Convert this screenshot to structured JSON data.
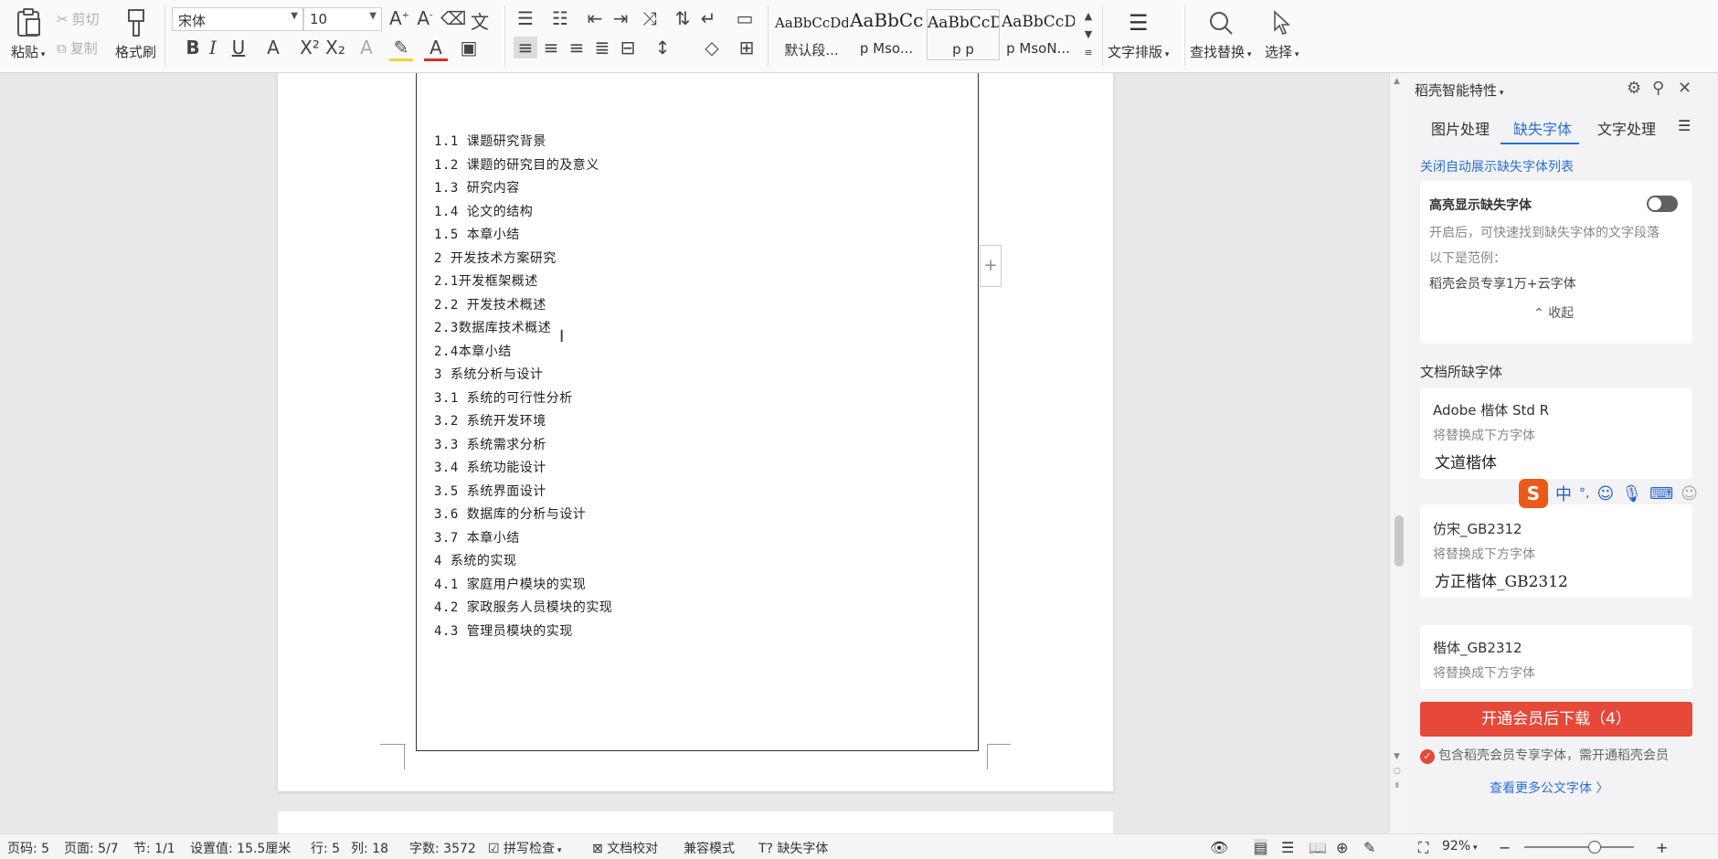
{
  "toolbar": {
    "paste": "粘贴",
    "cut": "剪切",
    "copy": "复制",
    "format_painter": "格式刷",
    "font_name": "宋体",
    "font_size": "10",
    "styles": [
      {
        "sample": "AaBbCcDd",
        "name": "默认段..."
      },
      {
        "sample": "AaBbCcI",
        "name": "p Mso..."
      },
      {
        "sample": "AaBbCcDd",
        "name": "p p"
      },
      {
        "sample": "AaBbCcDd",
        "name": "p MsoN..."
      }
    ],
    "text_layout": "文字排版",
    "find_replace": "查找替换",
    "select": "选择"
  },
  "document": {
    "toc": [
      "1.1  课题研究背景",
      "1.2  课题的研究目的及意义",
      "1.3 研究内容",
      "1.4 论文的结构",
      "1.5 本章小结",
      " 2 开发技术方案研究",
      "2.1开发框架概述",
      "2.2 开发技术概述",
      "2.3数据库技术概述",
      "2.4本章小结",
      " 3 系统分析与设计",
      "3.1 系统的可行性分析",
      "3.2 系统开发环境",
      "3.3 系统需求分析",
      "3.4 系统功能设计",
      "3.5 系统界面设计",
      "3.6 数据库的分析与设计",
      "3.7  本章小结",
      " 4 系统的实现",
      "4.1 家庭用户模块的实现",
      "4.2 家政服务人员模块的实现",
      "4.3 管理员模块的实现"
    ]
  },
  "panel": {
    "title": "稻壳智能特性",
    "tabs": [
      "图片处理",
      "缺失字体",
      "文字处理"
    ],
    "close_auto_link": "关闭自动展示缺失字体列表",
    "highlight_title": "高亮显示缺失字体",
    "highlight_desc": "开启后，可快速找到缺失字体的文字段落",
    "example_label": "以下是范例：",
    "example_text": "稻壳会员专享1万+云字体",
    "collapse": "收起",
    "missing_header": "文档所缺字体",
    "fonts": [
      {
        "name": "Adobe 楷体 Std R",
        "hint": "将替换成下方字体",
        "replacement": "文道楷体"
      },
      {
        "name": "仿宋_GB2312",
        "hint": "将替换成下方字体",
        "replacement": "方正楷体_GB2312"
      },
      {
        "name": "楷体_GB2312",
        "hint": "将替换成下方字体",
        "replacement": ""
      }
    ],
    "download_button": "开通会员后下载（4）",
    "member_note": "包含稻壳会员专享字体，需开通稻壳会员",
    "more_fonts": "查看更多公文字体 〉",
    "ime_chars": [
      "中",
      "°,"
    ]
  },
  "status": {
    "page_num": "页码: 5",
    "page": "页面: 5/7",
    "section": "节: 1/1",
    "setting": "设置值: 15.5厘米",
    "row": "行: 5",
    "col": "列: 18",
    "words": "字数: 3572",
    "spell": "拼写检查",
    "proof": "文档校对",
    "compat": "兼容模式",
    "missing_font": "缺失字体",
    "zoom": "92%"
  },
  "colors": {
    "accent": "#2a6fdb",
    "download": "#e6483a",
    "ime_logo": "#e95a1a"
  }
}
